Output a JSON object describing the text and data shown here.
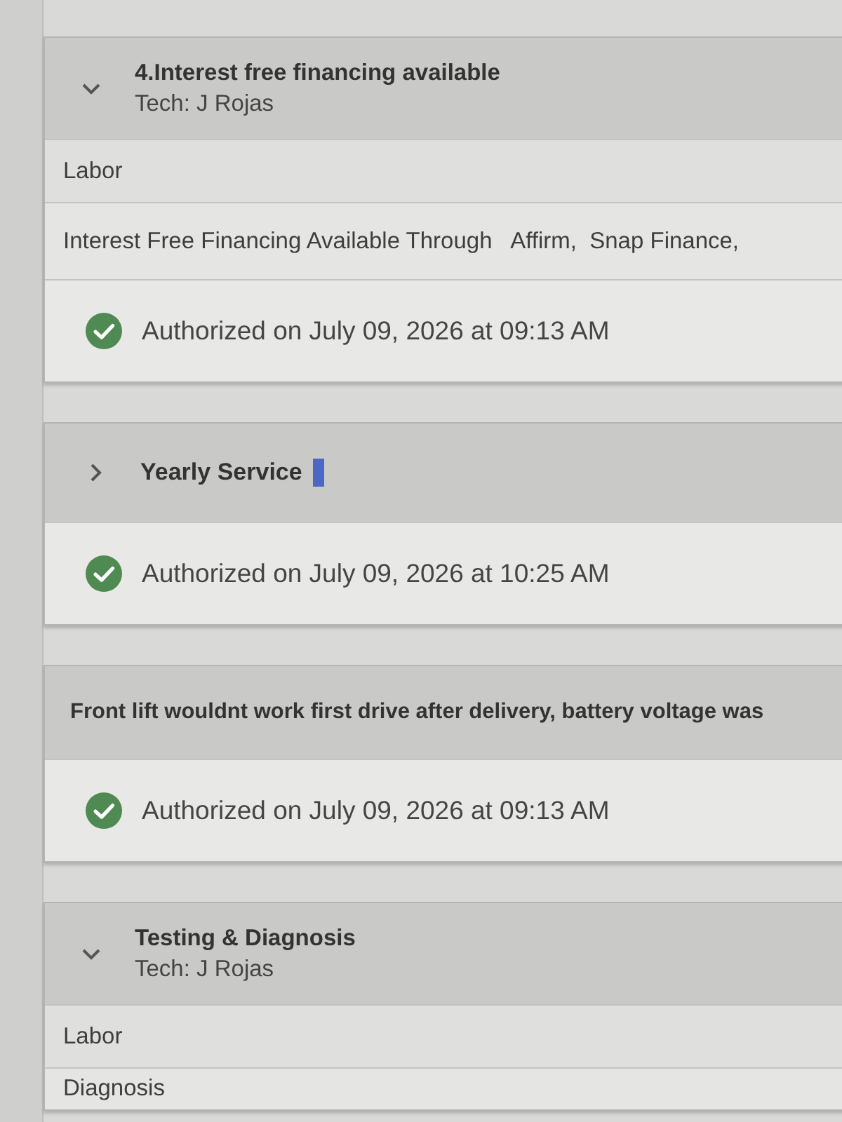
{
  "cards": [
    {
      "kind": "job",
      "expanded": true,
      "flagged": false,
      "title": "4.Interest free financing available",
      "tech": "Tech: J Rojas",
      "lines": [
        "Labor",
        "Interest Free Financing Available Through   Affirm,  Snap Finance,"
      ],
      "authorization": "Authorized on July 09, 2026 at 09:13 AM"
    },
    {
      "kind": "job",
      "expanded": false,
      "flagged": true,
      "title": "Yearly Service",
      "authorization": "Authorized on July 09, 2026 at 10:25 AM"
    },
    {
      "kind": "note",
      "text": "Front lift wouldnt work first drive after delivery, battery voltage was",
      "authorization": "Authorized on July 09, 2026 at 09:13 AM"
    },
    {
      "kind": "job",
      "expanded": true,
      "flagged": false,
      "title": "Testing & Diagnosis",
      "tech": "Tech: J Rojas",
      "lines": [
        "Labor",
        "Diagnosis"
      ]
    }
  ]
}
